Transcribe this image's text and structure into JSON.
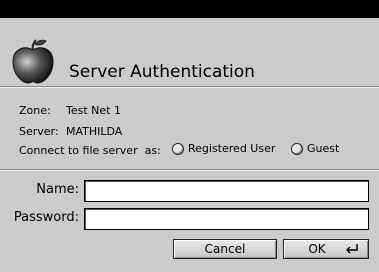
{
  "dialog": {
    "title": "Server Authentication",
    "icon": "apple-logo-icon"
  },
  "info": {
    "zone_label": "Zone:",
    "zone_value": "Test Net 1",
    "server_label": "Server:",
    "server_value": "MATHILDA",
    "connect_label": "Connect to file server  as:"
  },
  "options": {
    "registered_user": "Registered User",
    "guest": "Guest"
  },
  "form": {
    "name_label": "Name:",
    "name_value": "",
    "password_label": "Password:",
    "password_value": ""
  },
  "buttons": {
    "cancel": "Cancel",
    "ok": "OK"
  }
}
